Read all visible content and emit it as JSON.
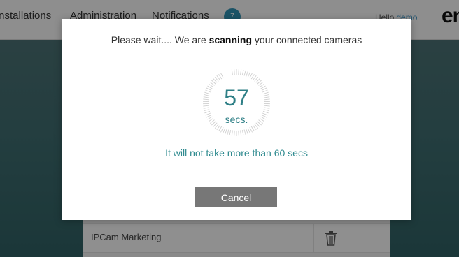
{
  "topbar": {
    "nav": [
      "Installations",
      "Administration",
      "Notifications"
    ],
    "notifications_count": "7",
    "greeting": "Hello",
    "user": "demo",
    "logo_text": "en"
  },
  "table": {
    "row_name": "IPCam Marketing",
    "delete_icon": "trash-icon"
  },
  "modal": {
    "title_prefix": "Please wait.... We are",
    "title_emphasis": "scanning",
    "title_suffix": "your connected cameras",
    "countdown_value": "57",
    "countdown_unit": "secs.",
    "countdown_total": 60,
    "note": "It will not take more than 60 secs",
    "cancel_label": "Cancel"
  },
  "colors": {
    "accent": "#2e7f86",
    "overlay": "rgba(0,0,0,0.42)",
    "cancel_button": "#777777"
  }
}
